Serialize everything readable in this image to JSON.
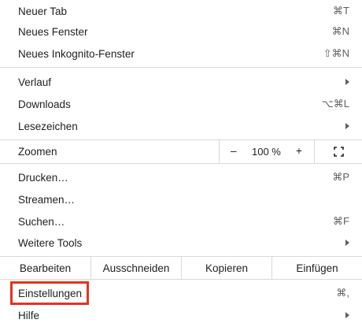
{
  "menu": {
    "new_tab": {
      "label": "Neuer Tab",
      "shortcut": "⌘T"
    },
    "new_window": {
      "label": "Neues Fenster",
      "shortcut": "⌘N"
    },
    "new_incognito": {
      "label": "Neues Inkognito-Fenster",
      "shortcut": "⇧⌘N"
    },
    "history": {
      "label": "Verlauf"
    },
    "downloads": {
      "label": "Downloads",
      "shortcut": "⌥⌘L"
    },
    "bookmarks": {
      "label": "Lesezeichen"
    },
    "zoom": {
      "label": "Zoomen",
      "minus": "–",
      "value": "100 %",
      "plus": "+"
    },
    "print": {
      "label": "Drucken…",
      "shortcut": "⌘P"
    },
    "cast": {
      "label": "Streamen…"
    },
    "find": {
      "label": "Suchen…",
      "shortcut": "⌘F"
    },
    "more_tools": {
      "label": "Weitere Tools"
    },
    "edit": {
      "label": "Bearbeiten",
      "cut": "Ausschneiden",
      "copy": "Kopieren",
      "paste": "Einfügen"
    },
    "settings": {
      "label": "Einstellungen",
      "shortcut": "⌘,"
    },
    "help": {
      "label": "Hilfe"
    }
  },
  "colors": {
    "highlight_border": "#e8311c",
    "separator": "#d9d9d9"
  }
}
